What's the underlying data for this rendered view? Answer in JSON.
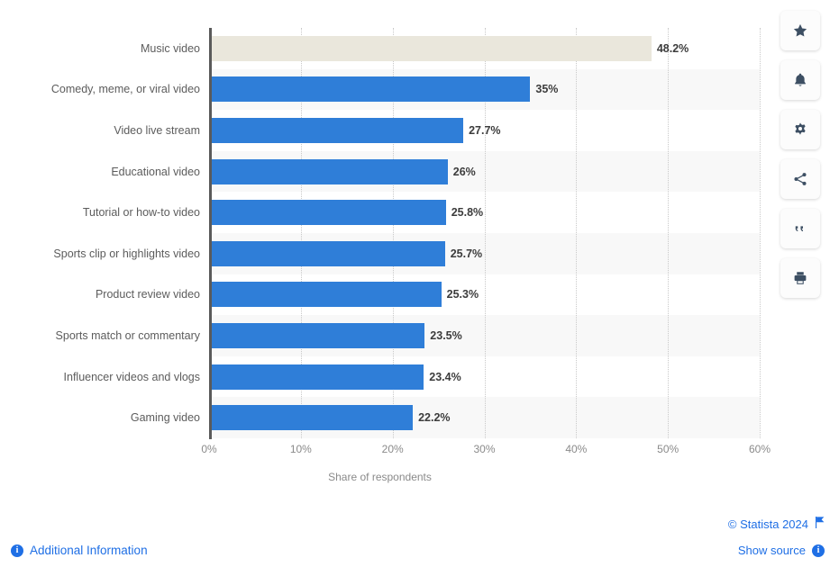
{
  "chart_data": {
    "type": "bar",
    "orientation": "horizontal",
    "title": "",
    "xlabel": "Share of respondents",
    "ylabel": "",
    "xlim": [
      0,
      60
    ],
    "xticks": [
      "0%",
      "10%",
      "20%",
      "30%",
      "40%",
      "50%",
      "60%"
    ],
    "xtick_values": [
      0,
      10,
      20,
      30,
      40,
      50,
      60
    ],
    "grid": true,
    "legend": "none",
    "categories": [
      "Music video",
      "Comedy, meme, or viral video",
      "Video live stream",
      "Educational video",
      "Tutorial or how-to video",
      "Sports clip or highlights video",
      "Product review video",
      "Sports match or commentary",
      "Influencer videos and vlogs",
      "Gaming video"
    ],
    "values": [
      48.2,
      35,
      27.7,
      26,
      25.8,
      25.7,
      25.3,
      23.5,
      23.4,
      22.2
    ],
    "labels": [
      "48.2%",
      "35%",
      "27.7%",
      "26%",
      "25.8%",
      "25.7%",
      "25.3%",
      "23.5%",
      "23.4%",
      "22.2%"
    ],
    "highlight_index": 0,
    "bar_color": "#2f7ed8",
    "highlight_color": "#eae7dc"
  },
  "toolbar": {
    "buttons": [
      {
        "name": "favorite",
        "icon": "star-icon"
      },
      {
        "name": "alert",
        "icon": "bell-icon"
      },
      {
        "name": "settings",
        "icon": "gear-icon"
      },
      {
        "name": "share",
        "icon": "share-icon"
      },
      {
        "name": "citation",
        "icon": "quote-icon"
      },
      {
        "name": "print",
        "icon": "print-icon"
      }
    ]
  },
  "footer": {
    "copyright": "© Statista 2024",
    "show_source": "Show source",
    "additional_information": "Additional Information",
    "link_color": "#1f6fe5"
  }
}
